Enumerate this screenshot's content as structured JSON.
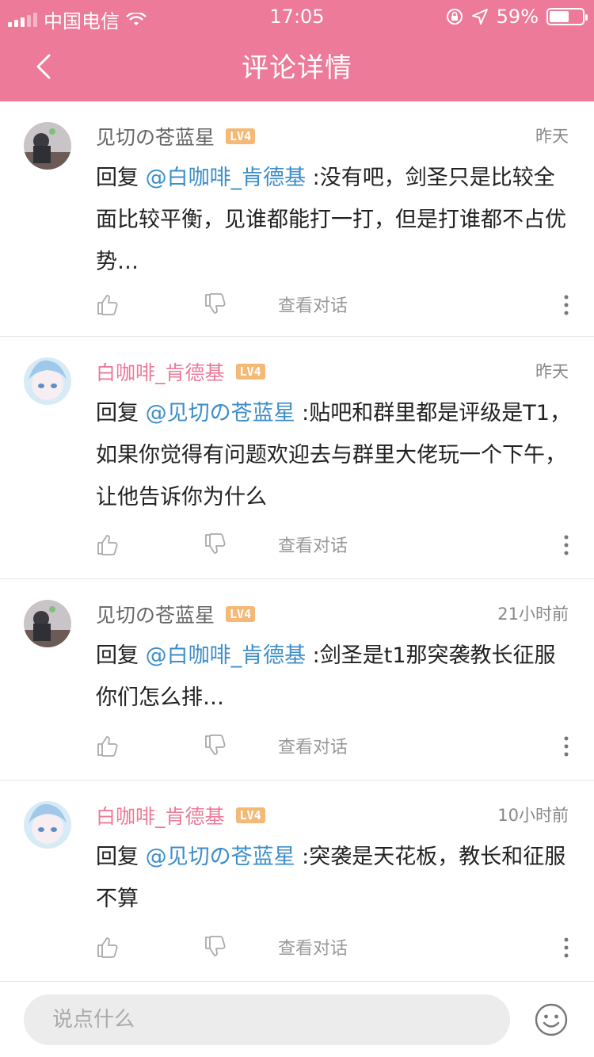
{
  "status_bar": {
    "carrier": "中国电信",
    "time": "17:05",
    "battery": "59%",
    "battery_level": 0.59
  },
  "header": {
    "title": "评论详情",
    "back_icon": "chevron-left-icon"
  },
  "comments": [
    {
      "username": "见切の苍蓝星",
      "username_color": "#666666",
      "level": "LV4",
      "time": "昨天",
      "reply_prefix": "回复 ",
      "mention": "@白咖啡_肯德基",
      "text": " :没有吧，剑圣只是比较全面比较平衡，见谁都能打一打，但是打谁都不占优势…",
      "view_dialog": "查看对话"
    },
    {
      "username": "白咖啡_肯德基",
      "username_color": "#ec7a98",
      "level": "LV4",
      "time": "昨天",
      "reply_prefix": "回复 ",
      "mention": "@见切の苍蓝星",
      "text": " :贴吧和群里都是评级是T1，如果你觉得有问题欢迎去与群里大佬玩一个下午，让他告诉你为什么",
      "view_dialog": "查看对话"
    },
    {
      "username": "见切の苍蓝星",
      "username_color": "#666666",
      "level": "LV4",
      "time": "21小时前",
      "reply_prefix": "回复 ",
      "mention": "@白咖啡_肯德基",
      "text": " :剑圣是t1那突袭教长征服你们怎么排…",
      "view_dialog": "查看对话"
    },
    {
      "username": "白咖啡_肯德基",
      "username_color": "#ec7a98",
      "level": "LV4",
      "time": "10小时前",
      "reply_prefix": "回复 ",
      "mention": "@见切の苍蓝星",
      "text": " :突袭是天花板，教长和征服不算",
      "view_dialog": "查看对话"
    }
  ],
  "input": {
    "placeholder": "说点什么",
    "emoji_icon": "smiley-icon"
  },
  "colors": {
    "header_bg": "#ec7a98",
    "mention": "#3d8ec9",
    "level_badge": "#f5b977"
  }
}
